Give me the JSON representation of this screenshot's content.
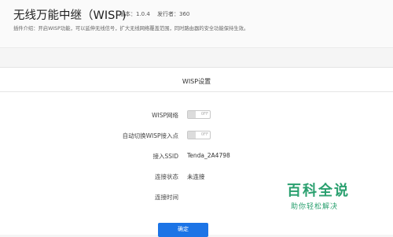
{
  "plugin": {
    "title": "无线万能中继（WISP)",
    "version": "版本：1.0.4",
    "developer": "发行者：360",
    "description": "插件介绍：开启WISP功能，可以延伸无线信号，扩大无线网络覆盖范围，同时路由器的安全功能保持生效。"
  },
  "settings": {
    "section_title": "WISP设置",
    "rows": [
      {
        "label": "WISP网络",
        "toggle_text": "OFF",
        "enabled": false
      },
      {
        "label": "自动切换WISP接入点",
        "toggle_text": "OFF",
        "enabled": false
      },
      {
        "label": "接入SSID",
        "value": "Tenda_2A4798"
      },
      {
        "label": "连接状态",
        "value": "未连接"
      },
      {
        "label": "连接时间",
        "value": ""
      }
    ],
    "confirm_label": "确定"
  },
  "watermark": {
    "logo": "百科全说",
    "tagline": "助你轻松解决"
  },
  "colors": {
    "accent": "#1c74e6",
    "watermark": "#2aa06f"
  }
}
